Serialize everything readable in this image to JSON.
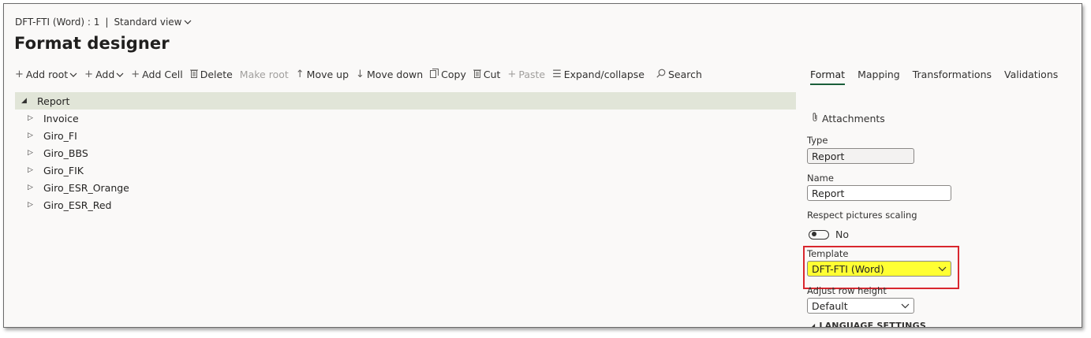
{
  "breadcrumb": {
    "item": "DFT-FTI (Word) : 1",
    "separator": "|",
    "view": "Standard view"
  },
  "page_title": "Format designer",
  "toolbar": [
    {
      "label": "Add root",
      "icon": "plus-icon",
      "chevron": true,
      "disabled": false
    },
    {
      "label": "Add",
      "icon": "plus-icon",
      "chevron": true,
      "disabled": false
    },
    {
      "label": "Add Cell",
      "icon": "plus-icon",
      "chevron": false,
      "disabled": false
    },
    {
      "label": "Delete",
      "icon": "trash-icon",
      "chevron": false,
      "disabled": false
    },
    {
      "label": "Make root",
      "icon": "",
      "chevron": false,
      "disabled": true
    },
    {
      "label": "Move up",
      "icon": "arrow-up-icon",
      "chevron": false,
      "disabled": false
    },
    {
      "label": "Move down",
      "icon": "arrow-down-icon",
      "chevron": false,
      "disabled": false
    },
    {
      "label": "Copy",
      "icon": "copy-icon",
      "chevron": false,
      "disabled": false
    },
    {
      "label": "Cut",
      "icon": "cut-icon",
      "chevron": false,
      "disabled": false
    },
    {
      "label": "Paste",
      "icon": "plus-icon",
      "chevron": false,
      "disabled": true
    },
    {
      "label": "Expand/collapse",
      "icon": "list-icon",
      "chevron": false,
      "disabled": false
    },
    {
      "label": "Search",
      "icon": "search-icon",
      "chevron": false,
      "disabled": false
    }
  ],
  "tree": {
    "root": "Report",
    "children": [
      "Invoice",
      "Giro_FI",
      "Giro_BBS",
      "Giro_FIK",
      "Giro_ESR_Orange",
      "Giro_ESR_Red"
    ]
  },
  "tabs": [
    "Format",
    "Mapping",
    "Transformations",
    "Validations"
  ],
  "panel": {
    "attachments": "Attachments",
    "type_label": "Type",
    "type_value": "Report",
    "name_label": "Name",
    "name_value": "Report",
    "scaling_label": "Respect pictures scaling",
    "scaling_value": "No",
    "template_label": "Template",
    "template_value": "DFT-FTI (Word)",
    "row_height_label": "Adjust row height",
    "row_height_value": "Default",
    "language_section": "LANGUAGE SETTINGS"
  },
  "colors": {
    "highlight_border": "#d9272e",
    "template_fill": "#ffff33",
    "accent": "#1a5e3a",
    "tree_root_bg": "#e1e5d8"
  }
}
